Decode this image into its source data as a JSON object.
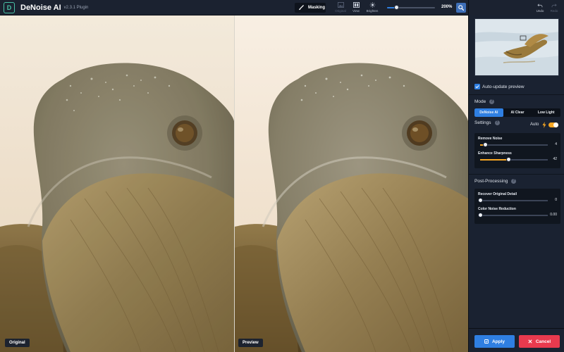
{
  "app": {
    "title": "DeNoise AI",
    "version": "v2.3.1 Plugin",
    "logo_letter": "D",
    "logo_color": "#49c2a7"
  },
  "toolbar": {
    "masking_label": "Masking",
    "original_label": "Original",
    "view_label": "View",
    "brighten_label": "Brighten",
    "zoom_label": "200%",
    "zoom_level": 0.2,
    "icons": [
      "brush-icon",
      "image-icon",
      "view-icon",
      "sun-icon",
      "search-icon"
    ]
  },
  "panes": {
    "left_label": "Original",
    "right_label": "Preview"
  },
  "panel": {
    "undo_label": "Undo",
    "redo_label": "Redo",
    "auto_update_label": "Auto-update preview",
    "auto_update_checked": true,
    "mode_title": "Mode",
    "modes": [
      {
        "label": "DeNoise AI",
        "active": true
      },
      {
        "label": "AI Clear",
        "active": false
      },
      {
        "label": "Low Light",
        "active": false
      }
    ],
    "settings_title": "Settings",
    "auto_label": "Auto",
    "auto_on": true,
    "settings_sliders": [
      {
        "label": "Remove Noise",
        "value": "4",
        "level": 0.08
      },
      {
        "label": "Enhance Sharpness",
        "value": "42",
        "level": 0.42
      }
    ],
    "post_title": "Post-Processing",
    "post_sliders": [
      {
        "label": "Recover Original Detail",
        "value": "0",
        "level": 0
      },
      {
        "label": "Color Noise Reduction",
        "value": "0.00",
        "level": 0
      }
    ],
    "apply_label": "Apply",
    "cancel_label": "Cancel"
  },
  "colors": {
    "accent": "#2f7fe2",
    "slider_fill": "#f6a623",
    "cancel": "#e83a4e",
    "toggle": "#f6a623"
  }
}
